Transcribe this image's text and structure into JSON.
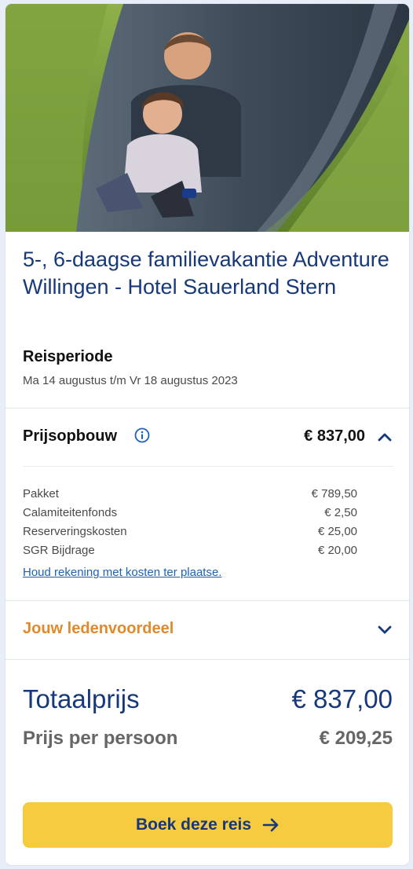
{
  "hero": {
    "icon": "family-slide-photo"
  },
  "title": "5-, 6-daagse familievakantie Adventure Willingen - Hotel Sauerland Stern",
  "period": {
    "label": "Reisperiode",
    "value": "Ma 14 augustus t/m Vr 18 augustus 2023"
  },
  "price_breakdown": {
    "label": "Prijsopbouw",
    "total": "€ 837,00",
    "expanded": true,
    "items": [
      {
        "label": "Pakket",
        "value": "€ 789,50"
      },
      {
        "label": "Calamiteitenfonds",
        "value": "€ 2,50"
      },
      {
        "label": "Reserveringskosten",
        "value": "€ 25,00"
      },
      {
        "label": "SGR Bijdrage",
        "value": "€ 20,00"
      }
    ],
    "link": "Houd rekening met kosten ter plaatse."
  },
  "member": {
    "label": "Jouw ledenvoordeel",
    "expanded": false
  },
  "totals": {
    "total_label": "Totaalprijs",
    "total_value": "€ 837,00",
    "pp_label": "Prijs per persoon",
    "pp_value": "€ 209,25"
  },
  "cta": {
    "label": "Boek deze reis"
  },
  "colors": {
    "brand_blue": "#17387a",
    "link_blue": "#1f61b3",
    "accent_orange": "#e08a2b",
    "cta_yellow": "#f6cb40"
  }
}
